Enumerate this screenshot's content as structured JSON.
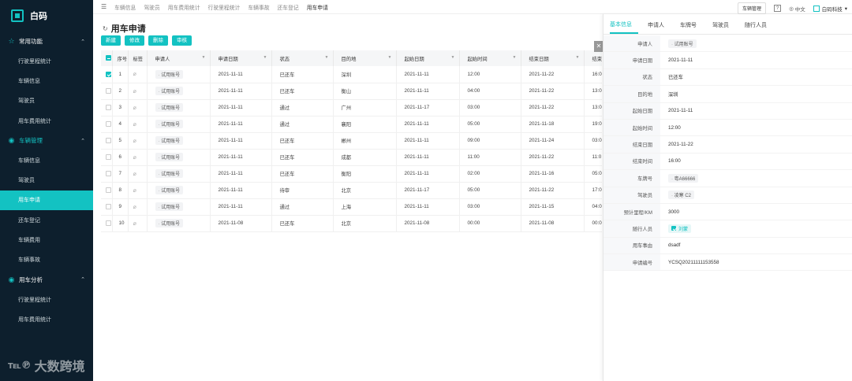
{
  "brand": {
    "name": "白码"
  },
  "sidebar": {
    "groups": [
      {
        "label": "常用功能",
        "icon": "star-icon",
        "items": [
          "行驶里程统计",
          "车辆信息",
          "驾驶员",
          "用车费用统计"
        ]
      },
      {
        "label": "车辆管理",
        "icon": "car-icon",
        "items": [
          "车辆信息",
          "驾驶员",
          "用车申请",
          "还车登记",
          "车辆费用",
          "车辆事故"
        ]
      },
      {
        "label": "用车分析",
        "icon": "chart-icon",
        "items": [
          "行驶里程统计",
          "用车费用统计"
        ]
      }
    ],
    "active_item": "用车申请"
  },
  "watermark": {
    "mark": "℡℗",
    "text": "大数跨境"
  },
  "topnav": {
    "tabs": [
      "车辆信息",
      "驾驶员",
      "用车费用统计",
      "行驶里程统计",
      "车辆事故",
      "还车登记",
      "用车申请"
    ],
    "vehicle_btn": "车辆管理",
    "help": "?",
    "lang": "中文",
    "org": "白码科技"
  },
  "page": {
    "title": "用车申请",
    "buttons": [
      "新建",
      "修改",
      "删除",
      "审核"
    ]
  },
  "table": {
    "headers": [
      "序号",
      "标签",
      "申请人",
      "申请日期",
      "状态",
      "目的地",
      "起始日期",
      "起始时间",
      "结束日期",
      "结束时间"
    ],
    "rows": [
      {
        "no": "1",
        "applicant": "试用账号",
        "date": "2021-11-11",
        "status": "已还车",
        "dest": "深圳",
        "start_date": "2021-11-11",
        "start_time": "12:00",
        "end_date": "2021-11-22",
        "end_time": "16:0",
        "checked": true
      },
      {
        "no": "2",
        "applicant": "试用账号",
        "date": "2021-11-11",
        "status": "已还车",
        "dest": "衡山",
        "start_date": "2021-11-11",
        "start_time": "04:00",
        "end_date": "2021-11-22",
        "end_time": "13:0",
        "checked": false
      },
      {
        "no": "3",
        "applicant": "试用账号",
        "date": "2021-11-11",
        "status": "通过",
        "dest": "广州",
        "start_date": "2021-11-17",
        "start_time": "03:00",
        "end_date": "2021-11-22",
        "end_time": "13:0",
        "checked": false
      },
      {
        "no": "4",
        "applicant": "试用账号",
        "date": "2021-11-11",
        "status": "通过",
        "dest": "襄阳",
        "start_date": "2021-11-11",
        "start_time": "05:00",
        "end_date": "2021-11-18",
        "end_time": "19:0",
        "checked": false
      },
      {
        "no": "5",
        "applicant": "试用账号",
        "date": "2021-11-11",
        "status": "已还车",
        "dest": "郴州",
        "start_date": "2021-11-11",
        "start_time": "09:00",
        "end_date": "2021-11-24",
        "end_time": "03:0",
        "checked": false
      },
      {
        "no": "6",
        "applicant": "试用账号",
        "date": "2021-11-11",
        "status": "已还车",
        "dest": "成都",
        "start_date": "2021-11-11",
        "start_time": "11:00",
        "end_date": "2021-11-22",
        "end_time": "11:0",
        "checked": false
      },
      {
        "no": "7",
        "applicant": "试用账号",
        "date": "2021-11-11",
        "status": "已还车",
        "dest": "衡阳",
        "start_date": "2021-11-11",
        "start_time": "02:00",
        "end_date": "2021-11-16",
        "end_time": "05:0",
        "checked": false
      },
      {
        "no": "8",
        "applicant": "试用账号",
        "date": "2021-11-11",
        "status": "待审",
        "dest": "北京",
        "start_date": "2021-11-17",
        "start_time": "05:00",
        "end_date": "2021-11-22",
        "end_time": "17:0",
        "checked": false
      },
      {
        "no": "9",
        "applicant": "试用账号",
        "date": "2021-11-11",
        "status": "通过",
        "dest": "上海",
        "start_date": "2021-11-11",
        "start_time": "03:00",
        "end_date": "2021-11-15",
        "end_time": "04:0",
        "checked": false
      },
      {
        "no": "10",
        "applicant": "试用账号",
        "date": "2021-11-08",
        "status": "已还车",
        "dest": "北京",
        "start_date": "2021-11-08",
        "start_time": "00:00",
        "end_date": "2021-11-08",
        "end_time": "00:0",
        "checked": false
      }
    ]
  },
  "panel": {
    "tabs": [
      "基本信息",
      "申请人",
      "车牌号",
      "驾驶员",
      "随行人员"
    ],
    "active_tab": "基本信息",
    "fields": [
      {
        "label": "申请人",
        "value": "试用账号",
        "kind": "tag"
      },
      {
        "label": "申请日期",
        "value": "2021-11-11",
        "kind": "text"
      },
      {
        "label": "状态",
        "value": "已还车",
        "kind": "text"
      },
      {
        "label": "目的地",
        "value": "深圳",
        "kind": "text"
      },
      {
        "label": "起始日期",
        "value": "2021-11-11",
        "kind": "text"
      },
      {
        "label": "起始时间",
        "value": "12:00",
        "kind": "text"
      },
      {
        "label": "结束日期",
        "value": "2021-11-22",
        "kind": "text"
      },
      {
        "label": "结束时间",
        "value": "16:00",
        "kind": "text"
      },
      {
        "label": "车牌号",
        "value": "粤A66666",
        "kind": "tag"
      },
      {
        "label": "驾驶员",
        "value": "凌寒 C2",
        "kind": "tag"
      },
      {
        "label": "预计里程/KM",
        "value": "3000",
        "kind": "text"
      },
      {
        "label": "随行人员",
        "value": "刘蒙",
        "kind": "chip"
      },
      {
        "label": "用车事由",
        "value": "dsadf",
        "kind": "text"
      },
      {
        "label": "申请编号",
        "value": "YCSQ20211111153558",
        "kind": "text"
      }
    ]
  },
  "colors": {
    "accent": "#13c2c2",
    "sidebar_bg": "#0d1f2d"
  }
}
